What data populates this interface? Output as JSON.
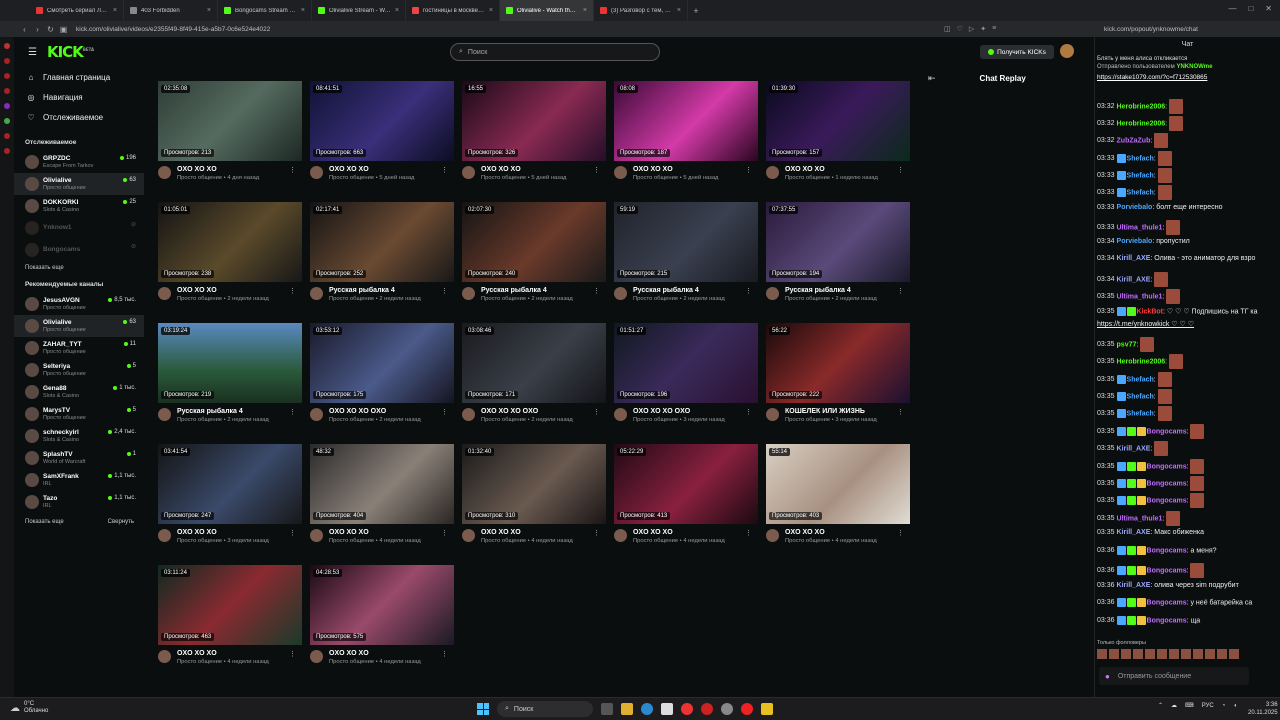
{
  "browser": {
    "tabs": [
      {
        "label": "Смотреть сериал Ланди",
        "color": "#e33"
      },
      {
        "label": "403 Forbidden",
        "color": "#888"
      },
      {
        "label": "Bongocams Stream - Wa",
        "color": "#53fc18"
      },
      {
        "label": "Olivialive Stream - Watch",
        "color": "#53fc18"
      },
      {
        "label": "гостиницы в москве —",
        "color": "#e44"
      },
      {
        "label": "Olivialive - Watch the VO",
        "color": "#53fc18"
      },
      {
        "label": "(3) Разговор с тем, кто",
        "color": "#e33"
      }
    ],
    "url": "kick.com/olivialive/videos/e2355f49-8f49-415e-a5b7-0c6e524e4022",
    "popup_url": "kick.com/popout/ynknowme/chat"
  },
  "sidebar": {
    "logo": "KICK",
    "logo_badge": "BETA",
    "nav": [
      {
        "label": "Главная страница",
        "icon": "home-icon"
      },
      {
        "label": "Навигация",
        "icon": "compass-icon"
      },
      {
        "label": "Отслеживаемое",
        "icon": "heart-icon"
      }
    ],
    "following_title": "Отслеживаемое",
    "following": [
      {
        "name": "GRPZDC",
        "cat": "Escape From Tarkov",
        "viewers": "196",
        "offline": false
      },
      {
        "name": "Olivialive",
        "cat": "Просто общение",
        "viewers": "63",
        "offline": false,
        "selected": true
      },
      {
        "name": "DOKKORKI",
        "cat": "Slots & Casino",
        "viewers": "25",
        "offline": false
      },
      {
        "name": "Ynknow1",
        "cat": "",
        "viewers": "",
        "offline": true
      },
      {
        "name": "Bongocams",
        "cat": "",
        "viewers": "",
        "offline": true
      }
    ],
    "show_more": "Показать еще",
    "recommended_title": "Рекомендуемые каналы",
    "recommended": [
      {
        "name": "JesusAVGN",
        "cat": "Просто общение",
        "viewers": "8,5 тыс."
      },
      {
        "name": "Olivialive",
        "cat": "Просто общение",
        "viewers": "63",
        "selected": true
      },
      {
        "name": "ZAHAR_TYT",
        "cat": "Просто общение",
        "viewers": "11"
      },
      {
        "name": "Selteriya",
        "cat": "Просто общение",
        "viewers": "5"
      },
      {
        "name": "Gena88",
        "cat": "Slots & Casino",
        "viewers": "1 тыс."
      },
      {
        "name": "MarysTV",
        "cat": "Просто общение",
        "viewers": "5"
      },
      {
        "name": "schneckyirl",
        "cat": "Slots & Casino",
        "viewers": "2,4 тыс."
      },
      {
        "name": "SplashTV",
        "cat": "World of Warcraft",
        "viewers": "1"
      },
      {
        "name": "SamXFrank",
        "cat": "IRL",
        "viewers": "1,1 тыс."
      },
      {
        "name": "Tazo",
        "cat": "IRL",
        "viewers": "1,1 тыс."
      }
    ],
    "show_more2": "Показать еще",
    "collapse": "Свернуть"
  },
  "header": {
    "search_placeholder": "Поиск",
    "kicks_button": "Получить KICKs"
  },
  "videos": [
    {
      "dur": "02:35:08",
      "views": "Просмотров: 213",
      "title": "OXO XO XO",
      "sub": "Просто общение • 4 дня назад",
      "bg": "linear-gradient(135deg,#2f3d36,#556b60 50%,#1d2824)"
    },
    {
      "dur": "08:41:51",
      "views": "Просмотров: 663",
      "title": "OXO XO XO",
      "sub": "Просто общение • 5 дней назад",
      "bg": "linear-gradient(135deg,#101335,#3a2f7a 55%,#0c0d22)"
    },
    {
      "dur": "16:55",
      "views": "Просмотров: 326",
      "title": "OXO XO XO",
      "sub": "Просто общение • 5 дней назад",
      "bg": "linear-gradient(135deg,#1a0a18,#8a2a52 55%,#240e2a)"
    },
    {
      "dur": "08:08",
      "views": "Просмотров: 187",
      "title": "OXO XO XO",
      "sub": "Просто общение • 5 дней назад",
      "bg": "linear-gradient(135deg,#3a0a36,#d43aa8 55%,#2a0620)"
    },
    {
      "dur": "01:39:30",
      "views": "Просмотров: 157",
      "title": "OXO XO XO",
      "sub": "Просто общение • 1 неделю назад",
      "bg": "linear-gradient(135deg,#0a0a1e,#3a1a5a 50%,#0a2a1a)"
    },
    {
      "dur": "01:05:01",
      "views": "Просмотров: 238",
      "title": "OXO XO XO",
      "sub": "Просто общение • 2 недели назад",
      "bg": "linear-gradient(135deg,#141414,#5a4a2a 55%,#181818)"
    },
    {
      "dur": "02:17:41",
      "views": "Просмотров: 252",
      "title": "Русская рыбалка 4",
      "sub": "Просто общение • 2 недели назад",
      "bg": "linear-gradient(135deg,#141414,#6a4a32 55%,#181818)"
    },
    {
      "dur": "02:07:30",
      "views": "Просмотров: 240",
      "title": "Русская рыбалка 4",
      "sub": "Просто общение • 2 недели назад",
      "bg": "linear-gradient(135deg,#141414,#6a3a2a 55%,#1a1a1a)"
    },
    {
      "dur": "59:19",
      "views": "Просмотров: 215",
      "title": "Русская рыбалка 4",
      "sub": "Просто общение • 2 недели назад",
      "bg": "linear-gradient(135deg,#20232a,#3a4050 55%,#181a20)"
    },
    {
      "dur": "07:37:55",
      "views": "Просмотров: 194",
      "title": "Русская рыбалка 4",
      "sub": "Просто общение • 2 недели назад",
      "bg": "linear-gradient(135deg,#2a1a3a,#5a4a7a 55%,#1a1a2a)"
    },
    {
      "dur": "03:19:24",
      "views": "Просмотров: 219",
      "title": "Русская рыбалка 4",
      "sub": "Просто общение • 2 недели назад",
      "bg": "linear-gradient(180deg,#5a8ac0,#2a5a3a 60%,#1a3020)"
    },
    {
      "dur": "03:53:12",
      "views": "Просмотров: 175",
      "title": "OXO XO XO OXO",
      "sub": "Просто общение • 2 недели назад",
      "bg": "linear-gradient(135deg,#1a1a2a,#4a5a8a 55%,#151520)"
    },
    {
      "dur": "03:08:46",
      "views": "Просмотров: 171",
      "title": "OXO XO XO OXO",
      "sub": "Просто общение • 2 недели назад",
      "bg": "linear-gradient(135deg,#1a1a1e,#3a3f48 55%,#141418)"
    },
    {
      "dur": "01:51:27",
      "views": "Просмотров: 196",
      "title": "OXO XO XO OXO",
      "sub": "Просто общение • 3 недели назад",
      "bg": "linear-gradient(135deg,#101820,#3a2a5a 50%,#2a1030)"
    },
    {
      "dur": "56:22",
      "views": "Просмотров: 222",
      "title": "КОШЕЛЕК ИЛИ ЖИЗНЬ",
      "sub": "Просто общение • 3 недели назад",
      "bg": "linear-gradient(135deg,#1a0a0a,#8a2a2a 50%,#1a1030)"
    },
    {
      "dur": "03:41:54",
      "views": "Просмотров: 247",
      "title": "OXO XO XO",
      "sub": "Просто общение • 3 недели назад",
      "bg": "linear-gradient(135deg,#141414,#3a4a6a 55%,#181818)"
    },
    {
      "dur": "48:32",
      "views": "Просмотров: 404",
      "title": "OXO XO XO",
      "sub": "Просто общение • 4 недели назад",
      "bg": "linear-gradient(135deg,#2a2a2a,#8a8078 55%,#2a2622)"
    },
    {
      "dur": "01:32:40",
      "views": "Просмотров: 310",
      "title": "OXO XO XO",
      "sub": "Просто общение • 4 недели назад",
      "bg": "linear-gradient(135deg,#1a1a1a,#6a5a50 55%,#1a1616)"
    },
    {
      "dur": "05:22:29",
      "views": "Просмотров: 413",
      "title": "OXO XO XO",
      "sub": "Просто общение • 4 недели назад",
      "bg": "linear-gradient(135deg,#200a14,#8a2040 55%,#1a0a10)"
    },
    {
      "dur": "55:14",
      "views": "Просмотров: 403",
      "title": "OXO XO XO",
      "sub": "Просто общение • 4 недели назад",
      "bg": "linear-gradient(135deg,#d8d0c4,#a89080 55%,#e0dcd4)"
    },
    {
      "dur": "03:11:24",
      "views": "Просмотров: 463",
      "title": "OXO XO XO",
      "sub": "Просто общение • 4 недели назад",
      "bg": "linear-gradient(135deg,#102a20,#8a2a30 50%,#1a3a2a)"
    },
    {
      "dur": "04:28:53",
      "views": "Просмотров: 575",
      "title": "OXO XO XO",
      "sub": "Просто общение • 4 недели назад",
      "bg": "linear-gradient(135deg,#1a0a14,#9a4a6a 50%,#1a1a24)"
    }
  ],
  "replay": {
    "title": "Chat Replay"
  },
  "chat": {
    "title": "Чат",
    "pinned_top": "Блять у меня алиса откликается",
    "pinned_by": "Отправлено пользователем",
    "pinned_user": "YNKNOWme",
    "pinned_link": "https://stake1079.com/?c=f712530865",
    "messages": [
      {
        "t": "03:32",
        "u": "Herobrine2006",
        "uc": "#53fc18",
        "text": "",
        "emote": true,
        "badges": 0
      },
      {
        "t": "03:32",
        "u": "Herobrine2006",
        "uc": "#53fc18",
        "text": "",
        "emote": true,
        "badges": 0
      },
      {
        "t": "03:32",
        "u": "ZubZaZub",
        "uc": "#c36bff",
        "text": "",
        "emote": true,
        "badges": 0
      },
      {
        "t": "03:33",
        "u": "Shefach",
        "uc": "#4aa8ff",
        "text": "",
        "emote": true,
        "badges": 1
      },
      {
        "t": "03:33",
        "u": "Shefach",
        "uc": "#4aa8ff",
        "text": "",
        "emote": true,
        "badges": 1
      },
      {
        "t": "03:33",
        "u": "Shefach",
        "uc": "#4aa8ff",
        "text": "",
        "emote": true,
        "badges": 1
      },
      {
        "t": "03:33",
        "u": "Porviebalo",
        "uc": "#4aa8ff",
        "text": "болт еще интересно",
        "emote": false,
        "badges": 0
      },
      {
        "t": "03:33",
        "u": "Ultima_thule1",
        "uc": "#c36bff",
        "text": "",
        "emote": true,
        "badges": 0
      },
      {
        "t": "03:34",
        "u": "Porviebalo",
        "uc": "#4aa8ff",
        "text": "пропустил",
        "emote": false,
        "badges": 0
      },
      {
        "t": "03:34",
        "u": "Kirill_AXE",
        "uc": "#9aa8ff",
        "text": "Олива - это аниматор для взро",
        "emote": false,
        "badges": 0
      },
      {
        "t": "03:34",
        "u": "Kirill_AXE",
        "uc": "#9aa8ff",
        "text": "",
        "emote": true,
        "badges": 0
      },
      {
        "t": "03:35",
        "u": "Ultima_thule1",
        "uc": "#c36bff",
        "text": "",
        "emote": true,
        "badges": 0
      },
      {
        "t": "03:35",
        "u": "KickBot",
        "uc": "#ff3c3c",
        "text": "♡ ♡ ♡ Подпишись на ТГ ка",
        "emote": false,
        "badges": 2
      },
      {
        "t": "",
        "u": "",
        "uc": "#fff",
        "text": "https://t.me/ynknowkick ♡ ♡ ♡",
        "emote": false,
        "badges": 0
      },
      {
        "t": "03:35",
        "u": "psv77",
        "uc": "#53fc18",
        "text": "",
        "emote": true,
        "badges": 0
      },
      {
        "t": "03:35",
        "u": "Herobrine2006",
        "uc": "#53fc18",
        "text": "",
        "emote": true,
        "badges": 0
      },
      {
        "t": "03:35",
        "u": "Shefach",
        "uc": "#4aa8ff",
        "text": "",
        "emote": true,
        "badges": 1
      },
      {
        "t": "03:35",
        "u": "Shefach",
        "uc": "#4aa8ff",
        "text": "",
        "emote": true,
        "badges": 1
      },
      {
        "t": "03:35",
        "u": "Shefach",
        "uc": "#4aa8ff",
        "text": "",
        "emote": true,
        "badges": 1
      },
      {
        "t": "03:35",
        "u": "Bongocams",
        "uc": "#c36bff",
        "text": "",
        "emote": true,
        "badges": 3
      },
      {
        "t": "03:35",
        "u": "Kirill_AXE",
        "uc": "#9aa8ff",
        "text": "",
        "emote": true,
        "badges": 0
      },
      {
        "t": "03:35",
        "u": "Bongocams",
        "uc": "#c36bff",
        "text": "",
        "emote": true,
        "badges": 3
      },
      {
        "t": "03:35",
        "u": "Bongocams",
        "uc": "#c36bff",
        "text": "",
        "emote": true,
        "badges": 3
      },
      {
        "t": "03:35",
        "u": "Bongocams",
        "uc": "#c36bff",
        "text": "",
        "emote": true,
        "badges": 3
      },
      {
        "t": "03:35",
        "u": "Ultima_thule1",
        "uc": "#c36bff",
        "text": "",
        "emote": true,
        "badges": 0
      },
      {
        "t": "03:35",
        "u": "Kirill_AXE",
        "uc": "#9aa8ff",
        "text": "Макс обиженка",
        "emote": false,
        "badges": 0
      },
      {
        "t": "03:36",
        "u": "Bongocams",
        "uc": "#c36bff",
        "text": "а меня?",
        "emote": false,
        "badges": 3
      },
      {
        "t": "03:36",
        "u": "Bongocams",
        "uc": "#c36bff",
        "text": "",
        "emote": true,
        "badges": 3
      },
      {
        "t": "03:36",
        "u": "Kirill_AXE",
        "uc": "#9aa8ff",
        "text": "олива через sim подрубит",
        "emote": false,
        "badges": 0
      },
      {
        "t": "03:36",
        "u": "Bongocams",
        "uc": "#c36bff",
        "text": "у неё батарейка са",
        "emote": false,
        "badges": 3
      },
      {
        "t": "03:36",
        "u": "Bongocams",
        "uc": "#c36bff",
        "text": "ща",
        "emote": false,
        "badges": 3
      }
    ],
    "followers_only": "Только фолловеры",
    "send_placeholder": "Отправить сообщение"
  },
  "taskbar": {
    "temp": "0°C",
    "weather": "Облачно",
    "search": "Поиск",
    "lang": "РУС",
    "time": "3:36",
    "date": "20.11.2025"
  }
}
